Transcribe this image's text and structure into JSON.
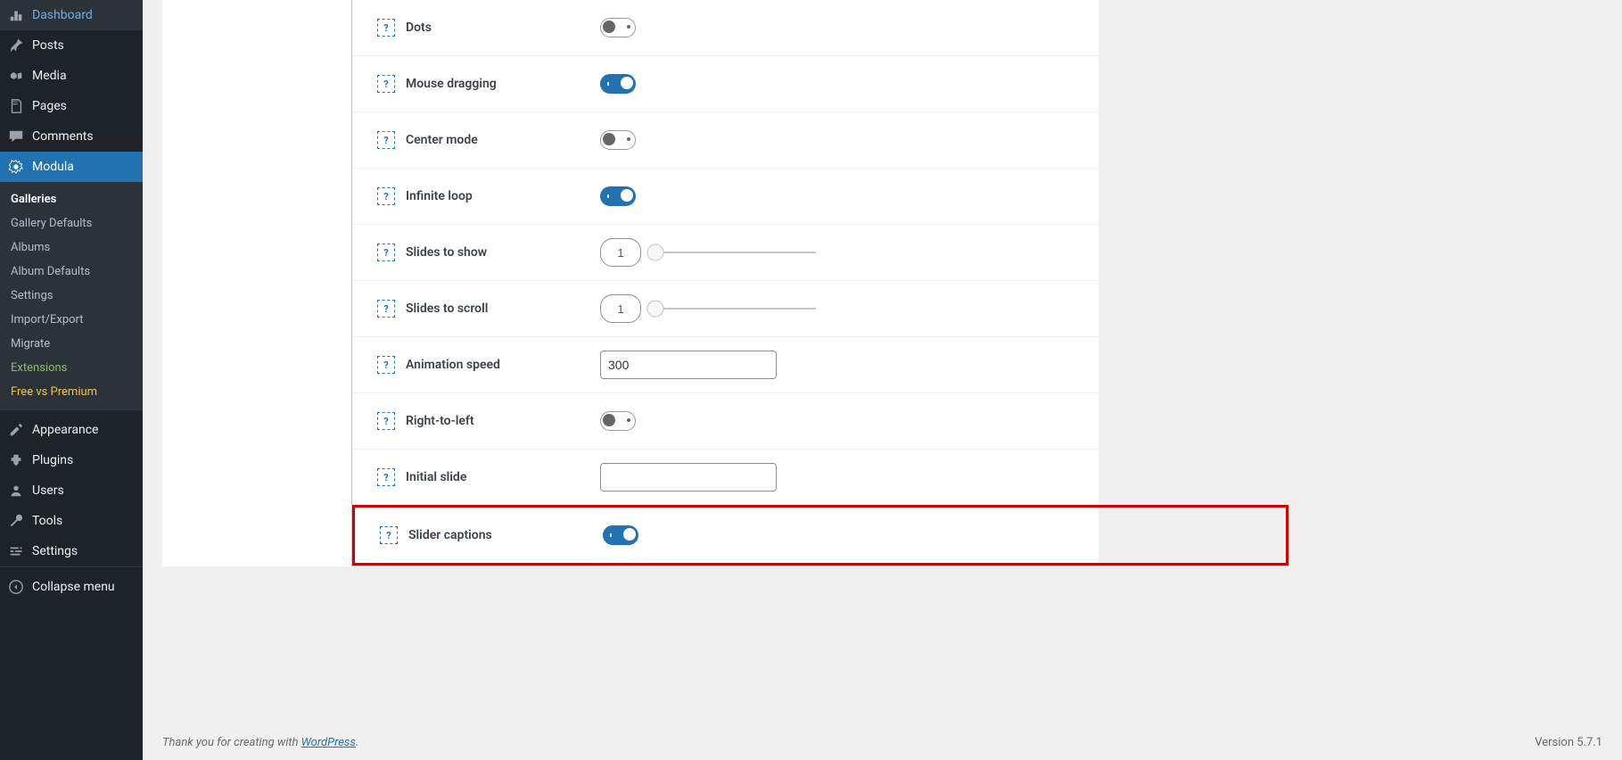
{
  "sidebar": {
    "dashboard": "Dashboard",
    "posts": "Posts",
    "media": "Media",
    "pages": "Pages",
    "comments": "Comments",
    "modula": "Modula",
    "appearance": "Appearance",
    "plugins": "Plugins",
    "users": "Users",
    "tools": "Tools",
    "settings": "Settings",
    "collapse": "Collapse menu",
    "submenu": {
      "galleries": "Galleries",
      "gallery_defaults": "Gallery Defaults",
      "albums": "Albums",
      "album_defaults": "Album Defaults",
      "settings": "Settings",
      "import_export": "Import/Export",
      "migrate": "Migrate",
      "extensions": "Extensions",
      "free_vs_premium": "Free vs Premium"
    }
  },
  "settings_panel": {
    "dots": {
      "label": "Dots",
      "value": false
    },
    "mouse_dragging": {
      "label": "Mouse dragging",
      "value": true
    },
    "center_mode": {
      "label": "Center mode",
      "value": false
    },
    "infinite_loop": {
      "label": "Infinite loop",
      "value": true
    },
    "slides_to_show": {
      "label": "Slides to show",
      "value": "1"
    },
    "slides_to_scroll": {
      "label": "Slides to scroll",
      "value": "1"
    },
    "animation_speed": {
      "label": "Animation speed",
      "value": "300"
    },
    "right_to_left": {
      "label": "Right-to-left",
      "value": false
    },
    "initial_slide": {
      "label": "Initial slide",
      "value": ""
    },
    "slider_captions": {
      "label": "Slider captions",
      "value": true
    }
  },
  "footer": {
    "prefix": "Thank you for creating with ",
    "link": "WordPress",
    "suffix": ".",
    "version": "Version 5.7.1"
  },
  "help_glyph": "?"
}
